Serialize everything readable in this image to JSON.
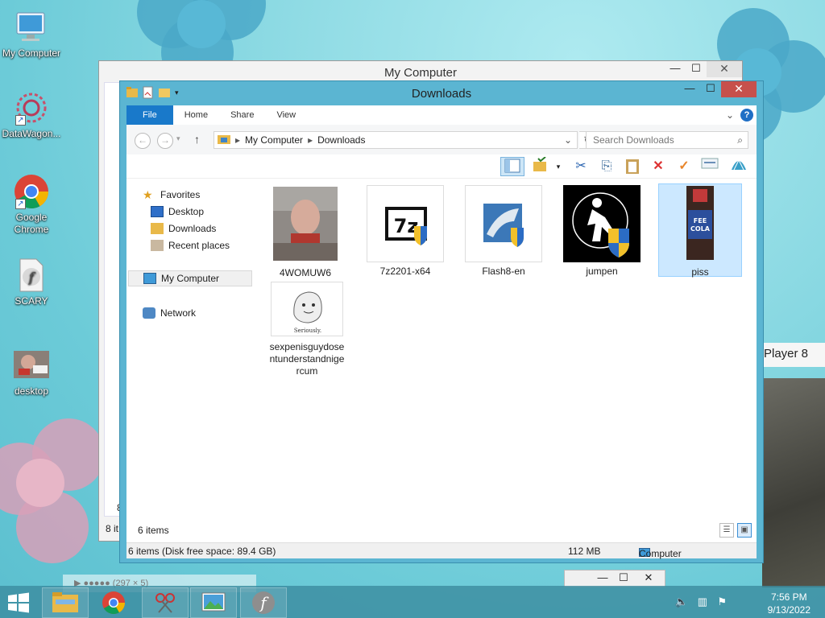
{
  "desktop": {
    "icons": [
      {
        "label": "My Computer",
        "icon": "monitor-icon"
      },
      {
        "label": "DataWagon...",
        "icon": "datawagon-icon"
      },
      {
        "label": "Google Chrome",
        "icon": "chrome-icon"
      },
      {
        "label": "SCARY",
        "icon": "flash-file-icon"
      },
      {
        "label": "desktop",
        "icon": "photo-icon"
      }
    ],
    "side_label": "Player 8",
    "ghost_text": "▶ ●●●●● (297 × 5)"
  },
  "back_window": {
    "title": "My Computer",
    "status": "8 it",
    "side_number": "8"
  },
  "window": {
    "title": "Downloads",
    "caption": {
      "minimize": "—",
      "maximize": "☐",
      "close": "✕"
    },
    "ribbon_tabs": [
      "File",
      "Home",
      "Share",
      "View"
    ],
    "address": {
      "root": "My Computer",
      "current": "Downloads"
    },
    "search_placeholder": "Search Downloads",
    "nav": {
      "favorites": "Favorites",
      "desktop": "Desktop",
      "downloads": "Downloads",
      "recent": "Recent places",
      "my_computer": "My Computer",
      "network": "Network"
    },
    "files": [
      {
        "name": "4WOMUW6",
        "type": "photo"
      },
      {
        "name": "7z2201-x64",
        "type": "installer-7z"
      },
      {
        "name": "Flash8-en",
        "type": "installer-flash"
      },
      {
        "name": "jumpen",
        "type": "installer-jumpen"
      },
      {
        "name": "piss",
        "type": "photo-bottle"
      },
      {
        "name": "sexpenisguydosentunderstandnigercum",
        "type": "image-ghost"
      }
    ],
    "item_count": "6 items",
    "status": {
      "summary": "6 items (Disk free space: 89.4 GB)",
      "size": "112 MB",
      "location": "Computer"
    }
  },
  "taskbar": {
    "time": "7:56 PM",
    "date": "9/13/2022"
  },
  "colors": {
    "accent": "#1979ca",
    "window_frame": "#5bb5d2",
    "selection": "#cce8ff",
    "close_button": "#c7504c"
  }
}
